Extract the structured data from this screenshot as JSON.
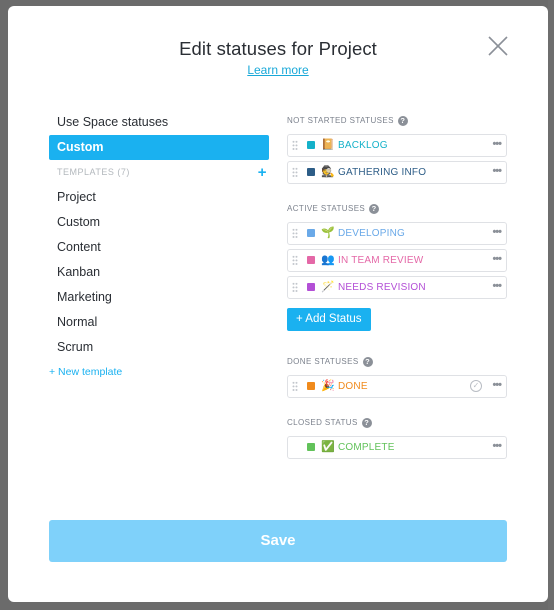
{
  "modal": {
    "title": "Edit statuses for Project",
    "learn_more": "Learn more",
    "close_icon": "close-icon",
    "save_label": "Save"
  },
  "left": {
    "options": [
      {
        "label": "Use Space statuses",
        "selected": false
      },
      {
        "label": "Custom",
        "selected": true
      }
    ],
    "templates_header": "TEMPLATES (7)",
    "add_icon": "+",
    "templates": [
      "Project",
      "Custom",
      "Content",
      "Kanban",
      "Marketing",
      "Normal",
      "Scrum"
    ],
    "new_template": "+ New template"
  },
  "sections": {
    "not_started": {
      "header": "NOT STARTED STATUSES",
      "help": "?",
      "items": [
        {
          "emoji": "📔",
          "name": "BACKLOG",
          "color": "#15b1c9"
        },
        {
          "emoji": "🕵️",
          "name": "GATHERING INFO",
          "color": "#2d5d87"
        }
      ]
    },
    "active": {
      "header": "ACTIVE STATUSES",
      "help": "?",
      "items": [
        {
          "emoji": "🌱",
          "name": "DEVELOPING",
          "color": "#6aa9e8"
        },
        {
          "emoji": "👥",
          "name": "IN TEAM REVIEW",
          "color": "#e468a7"
        },
        {
          "emoji": "🪄",
          "name": "NEEDS REVISION",
          "color": "#b34fd6"
        }
      ],
      "add_label": "+ Add Status"
    },
    "done": {
      "header": "DONE STATUSES",
      "help": "?",
      "items": [
        {
          "emoji": "🎉",
          "name": "DONE",
          "color": "#f08a1c"
        }
      ]
    },
    "closed": {
      "header": "CLOSED STATUS",
      "help": "?",
      "items": [
        {
          "emoji": "✅",
          "name": "COMPLETE",
          "color": "#62c25a"
        }
      ]
    }
  },
  "ellipsis": "•••",
  "check": "✓"
}
